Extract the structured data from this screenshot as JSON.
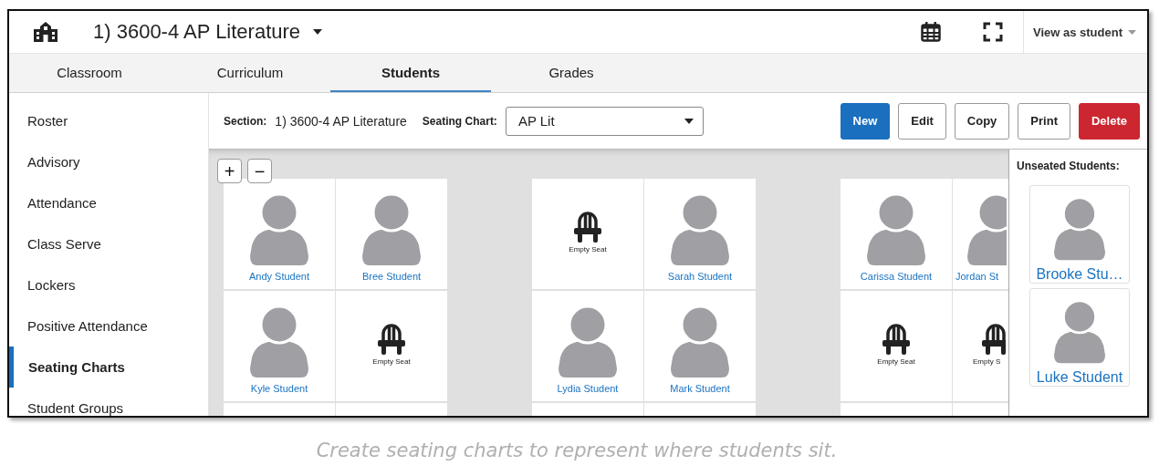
{
  "header": {
    "title": "1) 3600-4 AP Literature",
    "view_menu": "View as student"
  },
  "tabs": [
    {
      "label": "Classroom",
      "selected": false
    },
    {
      "label": "Curriculum",
      "selected": false
    },
    {
      "label": "Students",
      "selected": true
    },
    {
      "label": "Grades",
      "selected": false
    }
  ],
  "sidebar": {
    "items": [
      {
        "label": "Roster",
        "selected": false
      },
      {
        "label": "Advisory",
        "selected": false
      },
      {
        "label": "Attendance",
        "selected": false
      },
      {
        "label": "Class Serve",
        "selected": false
      },
      {
        "label": "Lockers",
        "selected": false
      },
      {
        "label": "Positive Attendance",
        "selected": false
      },
      {
        "label": "Seating Charts",
        "selected": true
      },
      {
        "label": "Student Groups",
        "selected": false
      }
    ]
  },
  "toolbar": {
    "section_label": "Section:",
    "section_value": "1) 3600-4 AP Literature",
    "chart_label": "Seating Chart:",
    "chart_value": "AP Lit",
    "buttons": [
      {
        "label": "New",
        "kind": "primary"
      },
      {
        "label": "Edit",
        "kind": "default"
      },
      {
        "label": "Copy",
        "kind": "default"
      },
      {
        "label": "Print",
        "kind": "default"
      },
      {
        "label": "Delete",
        "kind": "danger"
      }
    ]
  },
  "zoom": [
    "+",
    "−"
  ],
  "clusters": [
    {
      "cut": false,
      "rows": [
        [
          {
            "kind": "student",
            "name": "Andy Student"
          },
          {
            "kind": "student",
            "name": "Bree Student"
          }
        ],
        [
          {
            "kind": "student",
            "name": "Kyle Student"
          },
          {
            "kind": "empty",
            "name": "Empty Seat"
          }
        ],
        [
          {
            "kind": "blank"
          },
          {
            "kind": "blank"
          }
        ]
      ]
    },
    {
      "cut": false,
      "rows": [
        [
          {
            "kind": "empty",
            "name": "Empty Seat"
          },
          {
            "kind": "student",
            "name": "Sarah Student"
          }
        ],
        [
          {
            "kind": "student",
            "name": "Lydia Student"
          },
          {
            "kind": "student",
            "name": "Mark Student"
          }
        ],
        [
          {
            "kind": "blank"
          },
          {
            "kind": "blank"
          }
        ]
      ]
    },
    {
      "cut": true,
      "rows": [
        [
          {
            "kind": "student",
            "name": "Carissa Student"
          },
          {
            "kind": "student",
            "name": "Jordan St"
          }
        ],
        [
          {
            "kind": "empty",
            "name": "Empty Seat"
          },
          {
            "kind": "empty",
            "name": "Empty S"
          }
        ],
        [
          {
            "kind": "blank"
          },
          {
            "kind": "blank"
          }
        ]
      ]
    }
  ],
  "unseated": {
    "title": "Unseated Students:",
    "students": [
      {
        "name": "Brooke Stu…"
      },
      {
        "name": "Luke Student"
      }
    ]
  },
  "caption": "Create seating charts to represent where students sit."
}
